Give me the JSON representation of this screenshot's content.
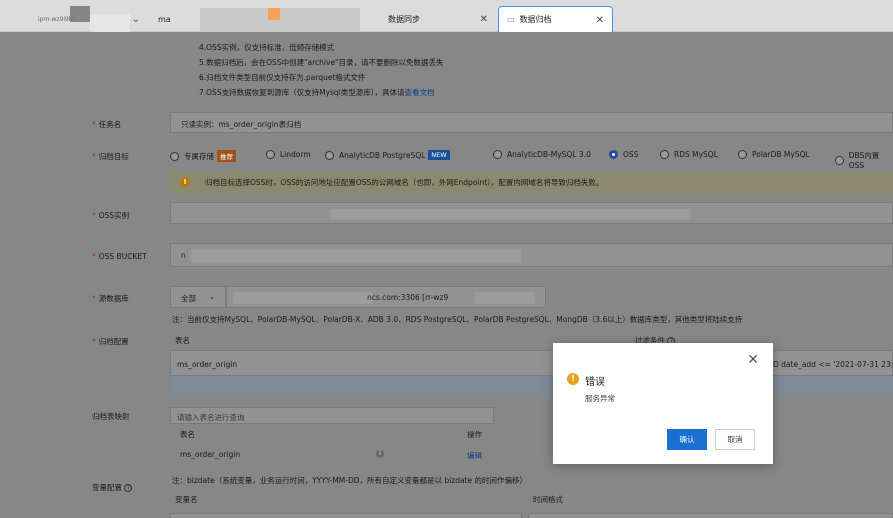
{
  "tabs": [
    {
      "label": "ipm-wz9i9l0i"
    },
    {
      "label": "ma"
    },
    {
      "label": "数据同步"
    },
    {
      "label": "数据归档"
    }
  ],
  "notes": [
    "4.OSS实例，仅支持标准、低频存储模式",
    "5.数据归档后，会在OSS中创建\"archive\"目录，请不要删除以免数据丢失",
    "6.归档文件类型目前仅支持存为.parquet格式文件",
    "7.OSS支持数据恢复到源库（仅支持Mysql类型源库），具体请"
  ],
  "notes_link": "查看文档",
  "form": {
    "task_name_label": "任务名",
    "task_name_value": "只读实例：ms_order_origin表归档",
    "target_label": "归档目标",
    "targets": [
      {
        "label": "专属存储",
        "badge": "推荐"
      },
      {
        "label": "Lindorm"
      },
      {
        "label": "AnalyticDB PostgreSQL",
        "badge": "NEW"
      },
      {
        "label": "AnalyticDB-MySQL 3.0"
      },
      {
        "label": "OSS"
      },
      {
        "label": "RDS MySQL"
      },
      {
        "label": "PolarDB MySQL"
      },
      {
        "label": "DBS内置OSS"
      }
    ],
    "selected_target": "OSS",
    "warning": "归档目标选择OSS时，OSS的访问地址应配置OSS的公网域名（也即，外网Endpoint），配置内网域名将导致归档失败。",
    "oss_instance_label": "OSS实例",
    "oss_bucket_label": "OSS BUCKET",
    "oss_bucket_value": "n",
    "source_db_label": "源数据库",
    "source_db_select": "全部",
    "source_db_value": "ncs.com:3306 [rr-wz9",
    "source_db_note": "注：当前仅支持MySQL、PolarDB-MySQL、PolarDB-X、ADB 3.0、RDS PostgreSQL、PolarDB PostgreSQL、MongDB（3.6以上）数据库类型，其他类型将陆续支持",
    "archive_config_label": "归档配置",
    "table_name_header": "表名",
    "filter_header": "过滤条件",
    "table_row_name": "ms_order_origin",
    "table_row_filter": "D date_add <= '2021-07-31 23:59",
    "mapping_label": "归档表映射",
    "mapping_search_placeholder": "请输入表名进行查询",
    "mapping_table_header": "表名",
    "mapping_action_header": "操作",
    "mapping_row_name": "ms_order_origin",
    "mapping_row_action": "编辑",
    "var_config_label": "变量配置",
    "var_note": "注：bizdate（系统变量，业务运行时间，YYYY-MM-DD，所有自定义变量都是以 bizdate 的时间作偏移）",
    "var_name_header": "变量名",
    "time_format_header": "时间格式"
  },
  "dialog": {
    "title": "错误",
    "message": "服务异常",
    "ok_label": "确认",
    "cancel_label": "取消"
  }
}
